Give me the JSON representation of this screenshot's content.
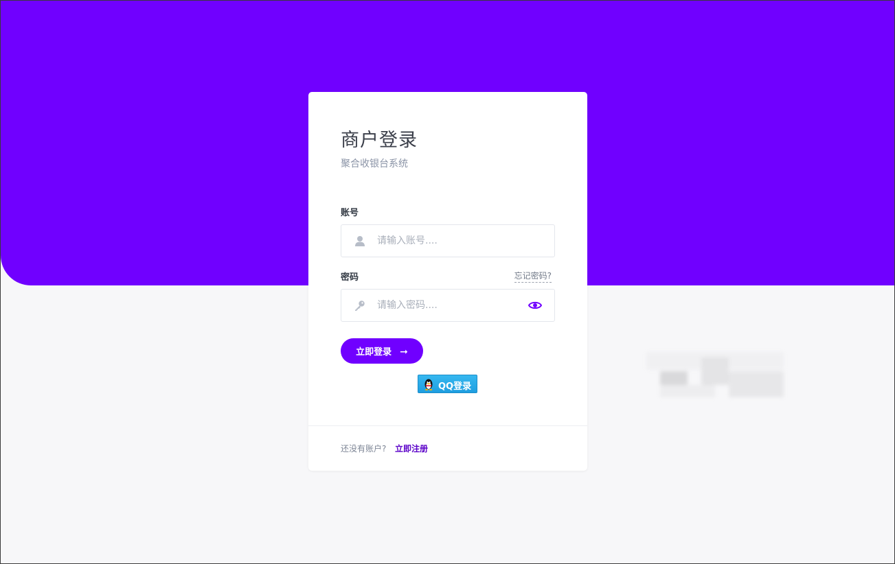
{
  "colors": {
    "brand": "#7000ff",
    "page_bg": "#f7f7f9",
    "card_bg": "#ffffff",
    "qq_blue": "#1f9ee0"
  },
  "login_card": {
    "title": "商户登录",
    "subtitle": "聚合收银台系统",
    "account": {
      "label": "账号",
      "placeholder": "请输入账号....",
      "value": "",
      "icon": "user-icon"
    },
    "password": {
      "label": "密码",
      "forgot_link": "忘记密码?",
      "placeholder": "请输入密码....",
      "value": "",
      "icon": "key-icon",
      "toggle_icon": "eye-icon"
    },
    "login_button": {
      "label": "立即登录",
      "icon": "arrow-right-icon"
    },
    "qq_button": {
      "label": "QQ登录",
      "icon": "qq-penguin-icon"
    },
    "footer": {
      "prompt": "还没有账户?",
      "register_link": "立即注册"
    }
  }
}
